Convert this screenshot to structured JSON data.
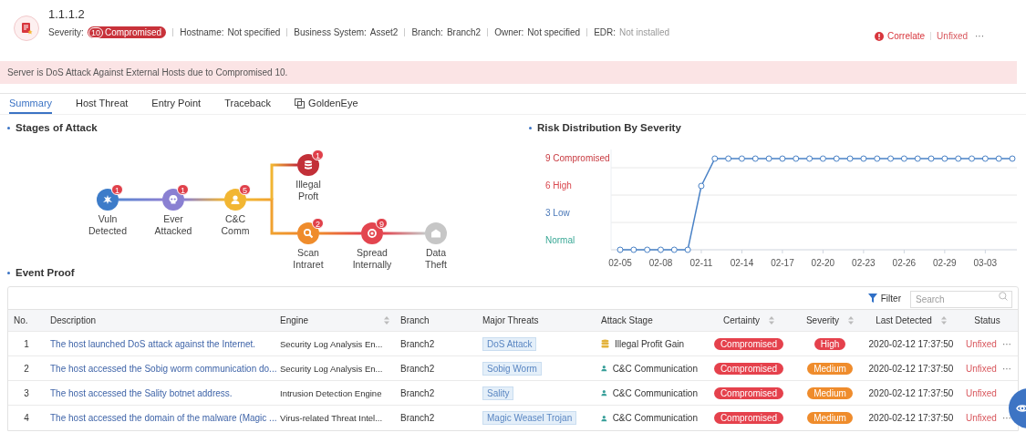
{
  "header": {
    "title": "1.1.1.2",
    "severity_label": "Severity:",
    "severity_score": "10",
    "severity_text": "Compromised",
    "fields": [
      {
        "label": "Hostname:",
        "value": "Not specified",
        "muted": false
      },
      {
        "label": "Business System:",
        "value": "Asset2",
        "muted": false
      },
      {
        "label": "Branch:",
        "value": "Branch2",
        "muted": false
      },
      {
        "label": "Owner:",
        "value": "Not specified",
        "muted": false
      },
      {
        "label": "EDR:",
        "value": "Not installed",
        "muted": true
      }
    ],
    "correlate": "Correlate",
    "status": "Unfixed",
    "more": "···"
  },
  "alert": "Server is DoS Attack Against External Hosts due to Compromised 10.",
  "tabs": [
    {
      "label": "Summary",
      "selected": true,
      "icon": false
    },
    {
      "label": "Host Threat",
      "selected": false,
      "icon": false
    },
    {
      "label": "Entry Point",
      "selected": false,
      "icon": false
    },
    {
      "label": "Traceback",
      "selected": false,
      "icon": false
    },
    {
      "label": "GoldenEye",
      "selected": false,
      "icon": true
    }
  ],
  "stages": {
    "title": "Stages of Attack",
    "nodes": [
      {
        "label": "Vuln Detected",
        "count": "1",
        "color": "#3d7cc9"
      },
      {
        "label": "Ever Attacked",
        "count": "1",
        "color": "#8a80d2"
      },
      {
        "label": "C&C Comm",
        "count": "5",
        "color": "#f2b632"
      },
      {
        "label": "Illegal Proft",
        "count": "1",
        "color": "#c23038"
      },
      {
        "label": "Scan Intraret",
        "count": "2",
        "color": "#ef8c2c"
      },
      {
        "label": "Spread Internally",
        "count": "9",
        "color": "#e3454f"
      },
      {
        "label": "Data Theft",
        "color": "#c6c6c6"
      }
    ]
  },
  "risk": {
    "title": "Risk Distribution By Severity",
    "chart_data": {
      "type": "line",
      "categories": [
        "02-05",
        null,
        null,
        "02-08",
        null,
        null,
        "02-11",
        null,
        null,
        "02-14",
        null,
        null,
        "02-17",
        null,
        null,
        "02-20",
        null,
        null,
        "02-23",
        null,
        null,
        "02-26",
        null,
        null,
        "02-29",
        null,
        null,
        "03-03",
        null,
        null
      ],
      "ylim": [
        0,
        11
      ],
      "series": [
        {
          "color": "#4a82c6",
          "marker": true,
          "values": [
            0,
            0,
            0,
            0,
            0,
            0,
            7,
            10,
            10,
            10,
            10,
            10,
            10,
            10,
            10,
            10,
            10,
            10,
            10,
            10,
            10,
            10,
            10,
            10,
            10,
            10,
            10,
            10,
            10,
            10
          ]
        }
      ],
      "grid": true,
      "yticks": [
        {
          "value": 0,
          "label": "Normal"
        },
        {
          "value": 3,
          "label": "3 Low"
        },
        {
          "value": 6,
          "label": "6 High"
        },
        {
          "value": 9,
          "label": "9 Compromised"
        }
      ]
    }
  },
  "events": {
    "title": "Event Proof",
    "filter": "Filter",
    "search": {
      "placeholder": "Search"
    },
    "columns": [
      {
        "label": "No.",
        "sortable": false
      },
      {
        "label": "Description",
        "sortable": false
      },
      {
        "label": "Engine",
        "sortable": true
      },
      {
        "label": "Branch",
        "sortable": false
      },
      {
        "label": "Major Threats",
        "sortable": false
      },
      {
        "label": "Attack Stage",
        "sortable": false
      },
      {
        "label": "Certainty",
        "sortable": true
      },
      {
        "label": "Severity",
        "sortable": true
      },
      {
        "label": "Last Detected",
        "sortable": true
      },
      {
        "label": "Status",
        "sortable": false
      }
    ],
    "rows": [
      {
        "no": "1",
        "description": "The host launched DoS attack against the Internet.",
        "engine": "Security Log Analysis En...",
        "branch": "Branch2",
        "threat": "DoS Attack",
        "stage": {
          "kind": "profit",
          "text": "Illegal Profit Gain"
        },
        "certainty": "Compromised",
        "severity": {
          "text": "High",
          "color": "#e5414c"
        },
        "detected": "2020-02-12 17:37:50",
        "status": "Unfixed",
        "more": "···"
      },
      {
        "no": "2",
        "description": "The host accessed the Sobig worm communication do...",
        "engine": "Security Log Analysis En...",
        "branch": "Branch2",
        "threat": "Sobig Worm",
        "stage": {
          "kind": "cc",
          "text": "C&C Communication"
        },
        "certainty": "Compromised",
        "severity": {
          "text": "Medium",
          "color": "#ef8c2c"
        },
        "detected": "2020-02-12 17:37:50",
        "status": "Unfixed",
        "more": "···"
      },
      {
        "no": "3",
        "description": "The host accessed the Sality botnet address.",
        "engine": "Intrusion Detection Engine",
        "branch": "Branch2",
        "threat": "Sality",
        "stage": {
          "kind": "cc",
          "text": "C&C Communication"
        },
        "certainty": "Compromised",
        "severity": {
          "text": "Medium",
          "color": "#ef8c2c"
        },
        "detected": "2020-02-12 17:37:50",
        "status": "Unfixed"
      },
      {
        "no": "4",
        "description": "The host accessed the domain of the malware (Magic ...",
        "engine": "Virus-related Threat Intel...",
        "branch": "Branch2",
        "threat": "Magic Weasel Trojan",
        "stage": {
          "kind": "cc",
          "text": "C&C Communication"
        },
        "certainty": "Compromised",
        "severity": {
          "text": "Medium",
          "color": "#ef8c2c"
        },
        "detected": "2020-02-12 17:37:50",
        "status": "Unfixed",
        "more": "···"
      }
    ]
  }
}
